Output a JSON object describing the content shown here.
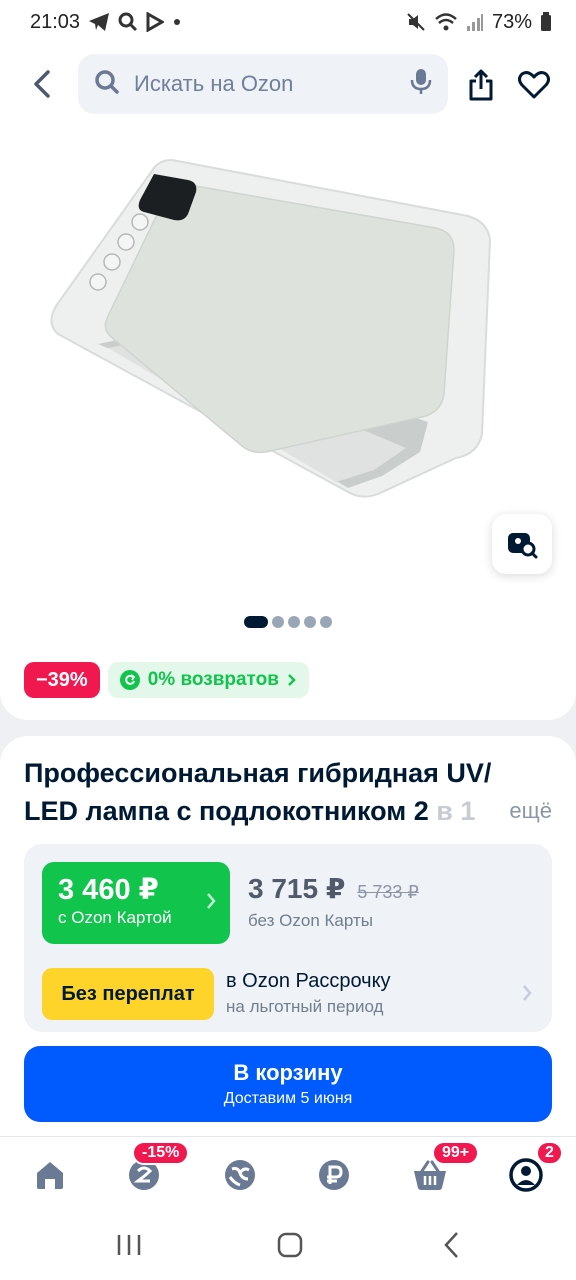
{
  "status_bar": {
    "time": "21:03",
    "battery": "73%",
    "icons_left": [
      "telegram-icon",
      "search-icon",
      "play-icon",
      "dot-icon"
    ],
    "icons_right": [
      "mute-icon",
      "wifi-icon",
      "signal-icon",
      "battery-icon"
    ]
  },
  "header": {
    "search_placeholder": "Искать на Ozon",
    "icons": [
      "back-icon",
      "search-icon",
      "microphone-icon",
      "share-icon",
      "heart-icon"
    ]
  },
  "gallery": {
    "image_count": 5,
    "active_index": 0,
    "visual_search_icon": "image-search-icon"
  },
  "badges": {
    "discount": "−39%",
    "returns": "0% возвратов"
  },
  "product": {
    "title_line1": "Профессиональная гибридная UV/",
    "title_line2": "LED лампа с подлокотником 2",
    "title_fade": "в 1",
    "more": "ещё"
  },
  "price": {
    "card_price": "3 460 ₽",
    "card_label": "с Ozon Картой",
    "regular_price": "3 715 ₽",
    "old_price": "5 733 ₽",
    "regular_label": "без Ozon Карты"
  },
  "installment": {
    "badge": "Без переплат",
    "title": "в Ozon Рассрочку",
    "subtitle": "на льготный период"
  },
  "cart": {
    "label": "В корзину",
    "delivery": "Доставим 5 июня"
  },
  "bottom_nav": {
    "items": [
      "home-icon",
      "promo-icon",
      "fresh-icon",
      "finance-icon",
      "cart-icon",
      "profile-icon"
    ],
    "promo_badge": "-15%",
    "cart_badge": "99+",
    "profile_badge": "2"
  },
  "colors": {
    "ozon_blue": "#005bff",
    "green": "#10c44c",
    "pink": "#f1174f",
    "yellow": "#fed42b"
  }
}
